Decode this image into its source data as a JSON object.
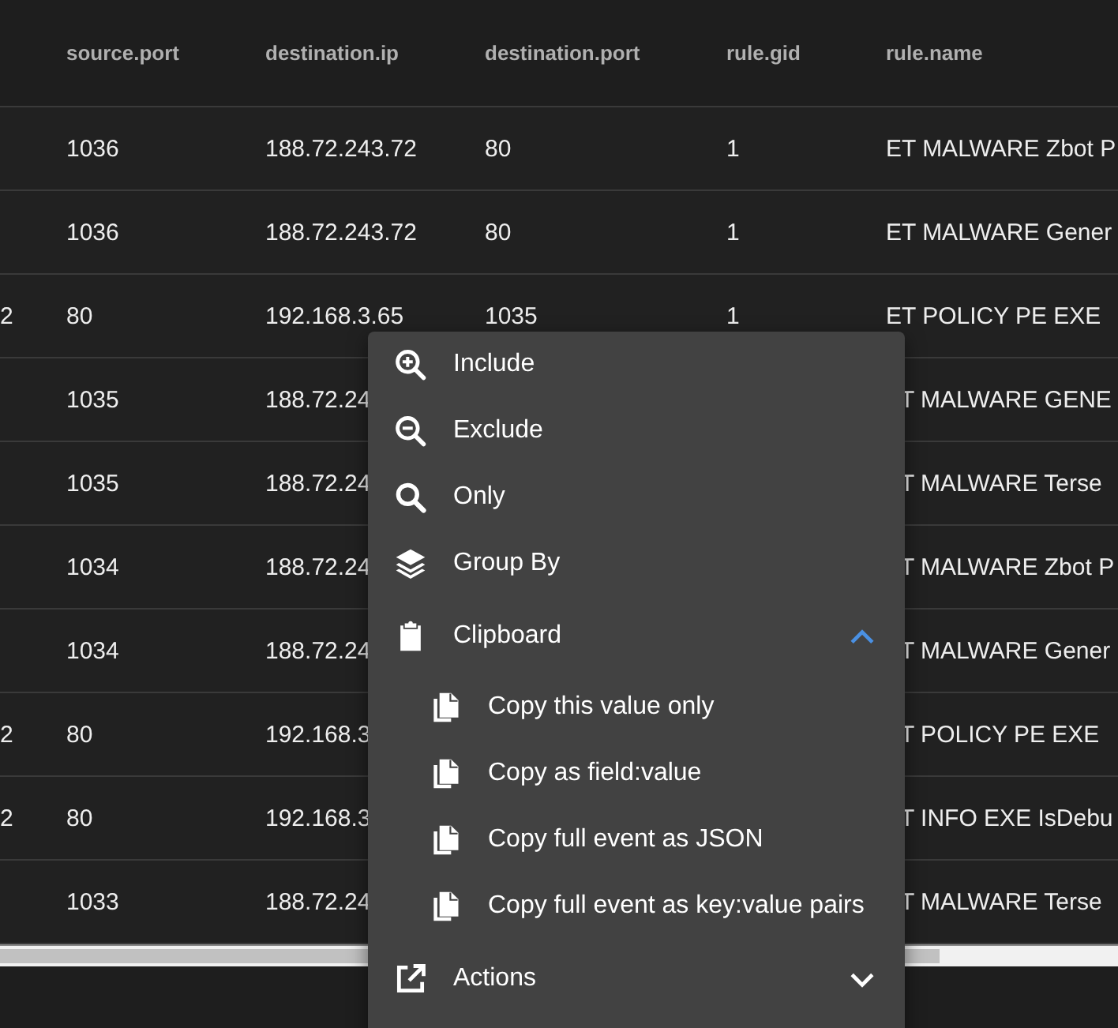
{
  "table": {
    "columns": [
      "source.port",
      "destination.ip",
      "destination.port",
      "rule.gid",
      "rule.name"
    ],
    "rows": [
      {
        "source_port": "1036",
        "destination_ip": "188.72.243.72",
        "destination_port": "80",
        "rule_gid": "1",
        "rule_name": "ET MALWARE Zbot P"
      },
      {
        "source_port": "1036",
        "destination_ip": "188.72.243.72",
        "destination_port": "80",
        "rule_gid": "1",
        "rule_name": "ET MALWARE Gener"
      },
      {
        "column_1": "2",
        "source_port": "80",
        "destination_ip": "192.168.3.65",
        "destination_port": "1035",
        "rule_gid": "1",
        "rule_name": "ET POLICY PE EXE"
      },
      {
        "source_port": "1035",
        "destination_ip": "188.72.24",
        "rule_name": "T MALWARE GENE"
      },
      {
        "source_port": "1035",
        "destination_ip": "188.72.24",
        "rule_name": "T MALWARE Terse"
      },
      {
        "source_port": "1034",
        "destination_ip": "188.72.24",
        "rule_name": "T MALWARE Zbot P"
      },
      {
        "source_port": "1034",
        "destination_ip": "188.72.24",
        "rule_name": "T MALWARE Gener"
      },
      {
        "column_1": "2",
        "source_port": "80",
        "destination_ip": "192.168.3",
        "rule_name": "T POLICY PE EXE"
      },
      {
        "column_1": "2",
        "source_port": "80",
        "destination_ip": "192.168.3",
        "rule_name": "T INFO EXE IsDebu"
      },
      {
        "source_port": "1033",
        "destination_ip": "188.72.24",
        "rule_name": "T MALWARE Terse"
      }
    ]
  },
  "context_menu": {
    "items": [
      {
        "kind": "item",
        "label": "Include"
      },
      {
        "kind": "item",
        "label": "Exclude"
      },
      {
        "kind": "item",
        "label": "Only"
      },
      {
        "kind": "item",
        "label": "Group By"
      },
      {
        "kind": "section",
        "label": "Clipboard",
        "expanded": true,
        "children": [
          {
            "label": "Copy this value only"
          },
          {
            "label": "Copy as field:value"
          },
          {
            "label": "Copy full event as JSON"
          },
          {
            "label": "Copy full event as key:value pairs"
          }
        ]
      },
      {
        "kind": "section",
        "label": "Actions",
        "expanded": false
      }
    ]
  }
}
